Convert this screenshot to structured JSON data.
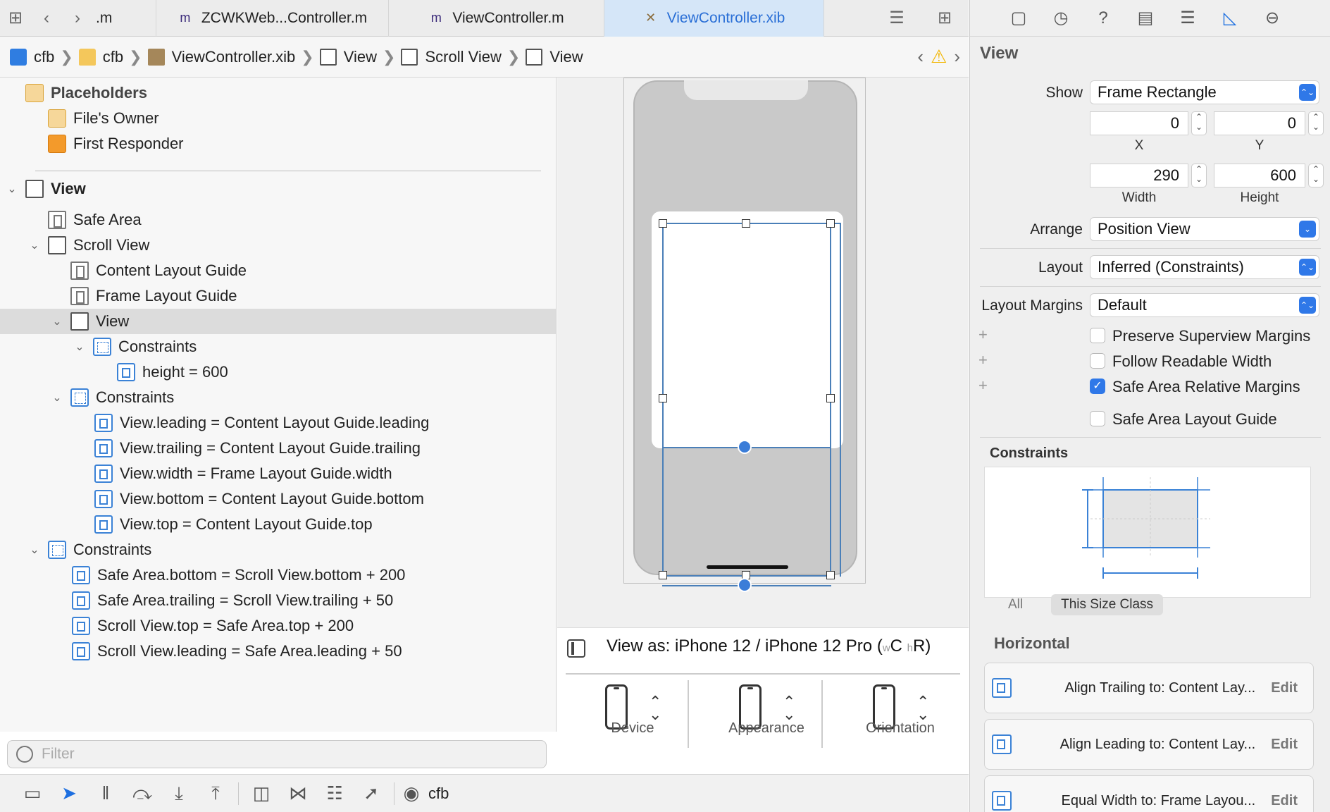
{
  "tabs": [
    {
      "icon": "m",
      "label": ".m",
      "active": false
    },
    {
      "icon": "m",
      "label": "ZCWKWeb...Controller.m",
      "active": false
    },
    {
      "icon": "m",
      "label": "ViewController.m",
      "active": false
    },
    {
      "icon": "xib",
      "label": "ViewController.xib",
      "active": true
    }
  ],
  "breadcrumb": [
    "cfb",
    "cfb",
    "ViewController.xib",
    "View",
    "Scroll View",
    "View"
  ],
  "outline": {
    "placeholders": "Placeholders",
    "files_owner": "File's Owner",
    "first_responder": "First Responder",
    "view": "View",
    "safe_area": "Safe Area",
    "scroll_view": "Scroll View",
    "content_layout_guide": "Content Layout Guide",
    "frame_layout_guide": "Frame Layout Guide",
    "inner_view": "View",
    "constraints_1": "Constraints",
    "height_constraint": "height = 600",
    "constraints_2": "Constraints",
    "c_leading": "View.leading = Content Layout Guide.leading",
    "c_trailing": "View.trailing = Content Layout Guide.trailing",
    "c_width": "View.width = Frame Layout Guide.width",
    "c_bottom": "View.bottom = Content Layout Guide.bottom",
    "c_top": "View.top = Content Layout Guide.top",
    "constraints_3": "Constraints",
    "s_bottom": "Safe Area.bottom = Scroll View.bottom + 200",
    "s_trailing": "Safe Area.trailing = Scroll View.trailing + 50",
    "s_top": "Scroll View.top = Safe Area.top + 200",
    "s_leading": "Scroll View.leading = Safe Area.leading + 50"
  },
  "filter": {
    "placeholder": "Filter"
  },
  "view_as": {
    "label": "View as: iPhone 12 / iPhone 12 Pro (",
    "w": "w",
    "wc": "C",
    "h": "h",
    "hr": "R)",
    "options": [
      "Device",
      "Appearance",
      "Orientation"
    ]
  },
  "bottom_toolbar": {
    "scheme": "cfb"
  },
  "inspector": {
    "title": "View",
    "show_label": "Show",
    "show_value": "Frame Rectangle",
    "x": "0",
    "y": "0",
    "x_label": "X",
    "y_label": "Y",
    "width": "290",
    "height": "600",
    "width_label": "Width",
    "height_label": "Height",
    "arrange_label": "Arrange",
    "arrange_value": "Position View",
    "layout_label": "Layout",
    "layout_value": "Inferred (Constraints)",
    "margins_label": "Layout Margins",
    "margins_value": "Default",
    "checkboxes": [
      {
        "label": "Preserve Superview Margins",
        "checked": false
      },
      {
        "label": "Follow Readable Width",
        "checked": false
      },
      {
        "label": "Safe Area Relative Margins",
        "checked": true
      },
      {
        "label": "Safe Area Layout Guide",
        "checked": false
      }
    ],
    "constraints_header": "Constraints",
    "size_tabs": [
      "All",
      "This Size Class"
    ],
    "horizontal_header": "Horizontal",
    "constraint_rows": [
      {
        "text": "Align Trailing to:  Content Lay...",
        "edit": "Edit"
      },
      {
        "text": "Align Leading to:  Content Lay...",
        "edit": "Edit"
      },
      {
        "text": "Equal Width to:  Frame Layou...",
        "edit": "Edit"
      }
    ]
  },
  "colors": {
    "accent": "#2f78e8",
    "selection": "#dcdcdc",
    "constraint_blue": "#3b82d6"
  }
}
